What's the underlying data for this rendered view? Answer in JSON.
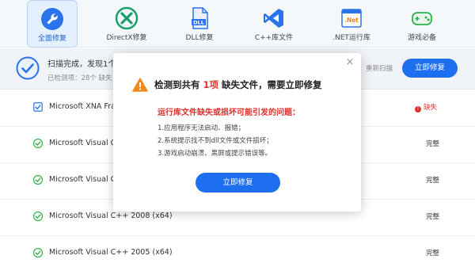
{
  "toolbar": {
    "items": [
      {
        "label": "全面修复",
        "icon": "wrench-icon",
        "active": true
      },
      {
        "label": "DirectX修复",
        "icon": "directx-icon"
      },
      {
        "label": "DLL修复",
        "icon": "dll-file-icon",
        "icon_text": "DLL"
      },
      {
        "label": "C++库文件",
        "icon": "visual-studio-icon"
      },
      {
        "label": ".NET运行库",
        "icon": "dotnet-icon",
        "icon_text": ".Net"
      },
      {
        "label": "游戏必备",
        "icon": "gamepad-icon"
      }
    ]
  },
  "scan": {
    "title": "扫描完成，发现1个",
    "subtitle": "已检测项：28个  缺失",
    "rescan_label": "重新扫描",
    "fix_label": "立即修复"
  },
  "list": [
    {
      "name": "Microsoft XNA Fram",
      "status": "缺失",
      "state": "missing"
    },
    {
      "name": "Microsoft Visual C++",
      "status": "完整",
      "state": "ok"
    },
    {
      "name": "Microsoft Visual C++",
      "status": "完整",
      "state": "ok"
    },
    {
      "name": "Microsoft Visual C++ 2008 (x64)",
      "status": "完整",
      "state": "ok"
    },
    {
      "name": "Microsoft Visual C++ 2005 (x64)",
      "status": "完整",
      "state": "ok"
    }
  ],
  "modal": {
    "close_label": "×",
    "title_before": "检测到共有",
    "title_highlight": "1项",
    "title_after": "缺失文件，需要立即修复",
    "subtitle": "运行库文件缺失或损坏可能引发的问题：",
    "lines": [
      "1.应用程序无法启动、报错；",
      "2.系统提示找不到dll文件或文件损坏；",
      "3.游戏启动崩溃、黑屏或提示错误等。"
    ],
    "fix_label": "立即修复"
  },
  "colors": {
    "accent": "#1d6ff0",
    "danger": "#e0302c",
    "ok": "#2db24a"
  }
}
